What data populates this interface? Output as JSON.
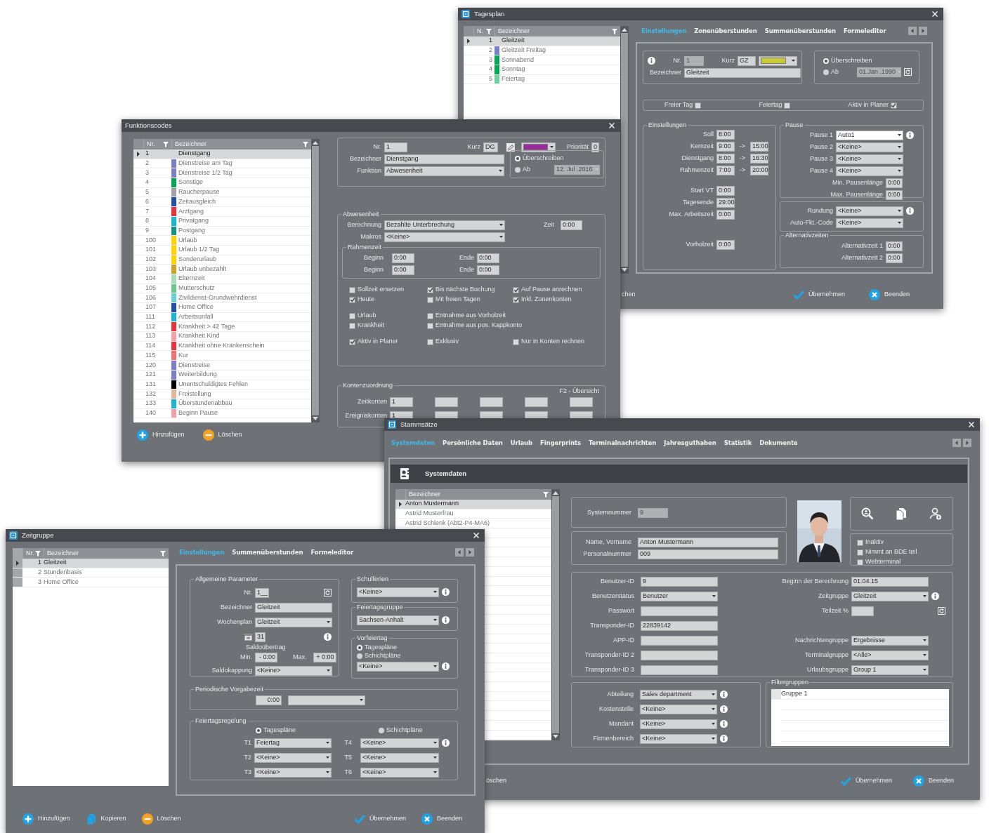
{
  "tagesplan": {
    "title": "Tagesplan",
    "icon": true,
    "list": {
      "columns": [
        "N.",
        "Bezeichner"
      ],
      "rows": [
        {
          "nr": "1",
          "name": "Gleitzeit",
          "selected": true
        },
        {
          "nr": "2",
          "name": "Gleitzeit Freitag",
          "color": "#7b7fc8",
          "selected": false
        },
        {
          "nr": "3",
          "name": "Sonnabend",
          "color": "#00a651",
          "selected": false
        },
        {
          "nr": "4",
          "name": "Sonntag",
          "color": "#00a651",
          "selected": false
        },
        {
          "nr": "5",
          "name": "Feiertag",
          "color": "#6fd0a2",
          "selected": false
        }
      ]
    },
    "tabs": [
      {
        "label": "Einstellungen",
        "selected": true
      },
      {
        "label": "Zonenüberstunden",
        "selected": false
      },
      {
        "label": "Summenüberstunden",
        "selected": false
      },
      {
        "label": "Formeleditor",
        "selected": false
      }
    ],
    "nr": {
      "label": "Nr.",
      "value": "1",
      "kind": "text",
      "disabled": true
    },
    "kurz": {
      "label": "Kurz",
      "value": "GZ",
      "kind": "text"
    },
    "color": {
      "kind": "color",
      "color": "#c9c930"
    },
    "bezeichner": {
      "label": "Bezeichner",
      "value": "Gleitzeit",
      "kind": "text"
    },
    "validity": {
      "options": [
        {
          "label": "Überschreiben",
          "selected": true
        },
        {
          "label": "Ab",
          "selected": false
        }
      ],
      "date": {
        "value": "01.Jan .1990",
        "kind": "date",
        "disabled": true
      }
    },
    "flags": [
      {
        "label": "Freier Tag",
        "checked": false
      },
      {
        "label": "Feiertag",
        "checked": false
      },
      {
        "label": "Aktiv in Planer",
        "checked": true
      }
    ],
    "einstellungen": {
      "title": "Einstellungen",
      "sections": [
        [
          {
            "label": "Soll",
            "from": "8:00"
          },
          {
            "label": "Kernzeit",
            "from": "9:00",
            "arrow": "->",
            "to": "15:00"
          },
          {
            "label": "Dienstgang",
            "from": "8:00",
            "arrow": "->",
            "to": "16:30"
          },
          {
            "label": "Rahmenzeit",
            "from": "7:00",
            "arrow": "->",
            "to": "20:00"
          }
        ],
        [
          {
            "label": "Start VT",
            "from": "0:00"
          },
          {
            "label": "Tagesende",
            "from": "29:00"
          },
          {
            "label": "Max. Arbeitszeit",
            "from": "0:00"
          }
        ],
        [
          {
            "label": "Vorholzeit",
            "from": "0:00"
          }
        ]
      ]
    },
    "pause": {
      "title": "Pause",
      "rows": [
        {
          "label": "Pause 1",
          "value": "Auto1",
          "kind": "combo",
          "focused": true,
          "info": true
        },
        {
          "label": "Pause 2",
          "value": "<Keine>",
          "kind": "combo"
        },
        {
          "label": "Pause 3",
          "value": "<Keine>",
          "kind": "combo"
        },
        {
          "label": "Pause 4",
          "value": "<Keine>",
          "kind": "combo"
        }
      ],
      "lengths": [
        {
          "label": "Min. Pausenlänge",
          "value": "0:00",
          "kind": "text"
        },
        {
          "label": "Max. Pausenlänge",
          "value": "0:00",
          "kind": "text"
        }
      ]
    },
    "rounding": {
      "rows": [
        {
          "label": "Rundung",
          "value": "<Keine>",
          "kind": "combo",
          "info": true
        },
        {
          "label": "Auto-Fkt.-Code",
          "value": "<Keine>",
          "kind": "combo"
        }
      ]
    },
    "alternatives": {
      "title": "Alternativzeiten",
      "rows": [
        {
          "label": "Alternativzeit 1",
          "value": "0:00",
          "kind": "text"
        },
        {
          "label": "Alternativzeit 2",
          "value": "0:00",
          "kind": "text"
        }
      ]
    },
    "footer": [
      {
        "kind": "fragment",
        "label": "chen"
      },
      {
        "kind": "apply",
        "label": "Übernehmen"
      },
      {
        "kind": "close",
        "label": "Beenden"
      }
    ]
  },
  "funktionscodes": {
    "title": "Funktionscodes",
    "list": {
      "columns": [
        "Nr.",
        "Bezeichner"
      ],
      "rows": [
        {
          "nr": "1",
          "name": "Dienstgang",
          "selected": true
        },
        {
          "nr": "2",
          "name": "Dienstreise am Tag",
          "color": "#7b7fc8",
          "selected": false
        },
        {
          "nr": "3",
          "name": "Dienstreise 1/2 Tag",
          "color": "#7b7fc8",
          "selected": false
        },
        {
          "nr": "4",
          "name": "Sonstige",
          "color": "#00a651",
          "selected": false
        },
        {
          "nr": "5",
          "name": "Raucherpause",
          "color": "#a0a0a8",
          "selected": false
        },
        {
          "nr": "6",
          "name": "Zeitausgleich",
          "color": "#1f4fa8",
          "selected": false
        },
        {
          "nr": "7",
          "name": "Arztgang",
          "color": "#e8323c",
          "selected": false
        },
        {
          "nr": "8",
          "name": "Privatgang",
          "color": "#19b5d2",
          "selected": false
        },
        {
          "nr": "9",
          "name": "Postgang",
          "color": "#14928a",
          "selected": false
        },
        {
          "nr": "100",
          "name": "Urlaub",
          "color": "#ffd200",
          "selected": false
        },
        {
          "nr": "101",
          "name": "Urlaub 1/2 Tag",
          "color": "#ffd200",
          "selected": false
        },
        {
          "nr": "102",
          "name": "Sonderurlaub",
          "color": "#ffd200",
          "selected": false
        },
        {
          "nr": "103",
          "name": "Urlaub unbezahlt",
          "color": "#c9a227",
          "selected": false
        },
        {
          "nr": "104",
          "name": "Elternzeit",
          "color": "#a8dcb8",
          "selected": false
        },
        {
          "nr": "105",
          "name": "Mutterschutz",
          "color": "#6cc98a",
          "selected": false
        },
        {
          "nr": "106",
          "name": "Zivildienst-Grundwehrdienst",
          "color": "#6ccfd0",
          "selected": false
        },
        {
          "nr": "107",
          "name": "Home Office",
          "color": "#1f4fa8",
          "selected": false
        },
        {
          "nr": "111",
          "name": "Arbeitsunfall",
          "color": "#19b5d2",
          "selected": false
        },
        {
          "nr": "112",
          "name": "Krankheit > 42 Tage",
          "color": "#e8323c",
          "selected": false
        },
        {
          "nr": "113",
          "name": "Krankheit Kind",
          "color": "#f4a0a8",
          "selected": false
        },
        {
          "nr": "114",
          "name": "Krankheit ohne Krankenschein",
          "color": "#e8323c",
          "selected": false
        },
        {
          "nr": "115",
          "name": "Kur",
          "color": "#ee7078",
          "selected": false
        },
        {
          "nr": "120",
          "name": "Dienstreise",
          "color": "#7b7fc8",
          "selected": false
        },
        {
          "nr": "121",
          "name": "Weiterbildung",
          "color": "#7b7fc8",
          "selected": false
        },
        {
          "nr": "131",
          "name": "Unentschuldigtes Fehlen",
          "color": "#000000",
          "selected": false
        },
        {
          "nr": "132",
          "name": "Freistellung",
          "color": "#e0b898",
          "selected": false
        },
        {
          "nr": "133",
          "name": "Überstundenabbau",
          "color": "#19b5d2",
          "selected": false
        },
        {
          "nr": "140",
          "name": "Beginn Pause",
          "color": "#f4a0a8",
          "selected": false
        }
      ]
    },
    "footer": [
      {
        "kind": "add",
        "label": "Hinzufügen"
      },
      {
        "kind": "remove",
        "label": "Löschen"
      }
    ],
    "nr": {
      "label": "Nr.",
      "value": "1",
      "kind": "text"
    },
    "kurz": {
      "label": "Kurz",
      "value": "DG",
      "kind": "text"
    },
    "color": {
      "kind": "color",
      "color": "#9b2aa0"
    },
    "prioritaet": {
      "label": "Priorität",
      "value": "0",
      "kind": "text"
    },
    "bezeichner": {
      "label": "Bezeichner",
      "value": "Dienstgang",
      "kind": "text"
    },
    "funktion": {
      "label": "Funktion",
      "value": "Abwesenheit",
      "kind": "combo"
    },
    "validity": {
      "options": [
        {
          "label": "Überschreiben",
          "selected": true
        },
        {
          "label": "Ab",
          "selected": false
        }
      ],
      "date": {
        "value": "12. Jul .2016",
        "kind": "date",
        "disabled": true
      }
    },
    "absence": {
      "title": "Abwesenheit",
      "berechnung": {
        "label": "Berechnung",
        "value": "Bezahlte Unterbrechung",
        "kind": "combo"
      },
      "zeit": {
        "label": "Zeit",
        "value": "0:00",
        "kind": "text"
      },
      "makros": {
        "label": "Makros",
        "value": "<Keine>",
        "kind": "combo"
      },
      "frame": {
        "title": "Rahmenzeit",
        "rows": [
          {
            "begin": {
              "label": "Beginn",
              "value": "0:00",
              "kind": "text"
            },
            "end": {
              "label": "Ende",
              "value": "0:00",
              "kind": "text"
            }
          },
          {
            "begin": {
              "label": "Beginn",
              "value": "0:00",
              "kind": "text"
            },
            "end": {
              "label": "Ende",
              "value": "0:00",
              "kind": "text"
            }
          }
        ]
      },
      "option_blocks": [
        {
          "columns": [
            [
              {
                "label": "Sollzeit ersetzen",
                "checked": false
              },
              {
                "label": "Heute",
                "checked": true
              }
            ],
            [
              {
                "label": "Bis nächste Buchung",
                "checked": true
              },
              {
                "label": "Mit freien Tagen",
                "checked": false
              }
            ],
            [
              {
                "label": "Auf Pause anrechnen",
                "checked": true
              },
              {
                "label": "Inkl. Zonenkonten",
                "checked": true
              }
            ]
          ]
        },
        {
          "columns": [
            [
              {
                "label": "Urlaub",
                "checked": false
              },
              {
                "label": "Krankheit",
                "checked": false
              }
            ],
            [
              {
                "label": "Entnahme aus Vorholzeit",
                "checked": false
              },
              {
                "label": "Entnahme aus pos. Kappkonto",
                "checked": false
              }
            ]
          ]
        },
        {
          "columns": [
            [
              {
                "label": "Aktiv in Planer",
                "checked": true
              }
            ],
            [
              {
                "label": "Exklusiv",
                "checked": false
              }
            ],
            [
              {
                "label": "Nur in Konten rechnen",
                "checked": false
              }
            ]
          ]
        }
      ]
    },
    "accounts": {
      "title": "Kontenzuordnung",
      "hint": "F2 - Übersicht",
      "rows": [
        {
          "label": "Zeitkonten",
          "values": [
            "1"
          ]
        },
        {
          "label": "Ereigniskonten",
          "values": [
            "1"
          ]
        }
      ]
    }
  },
  "stammsaetze": {
    "title": "Stammsätze",
    "icon": true,
    "tabs": [
      {
        "label": "Systemdaten",
        "selected": true
      },
      {
        "label": "Persönliche Daten",
        "selected": false
      },
      {
        "label": "Urlaub",
        "selected": false
      },
      {
        "label": "Fingerprints",
        "selected": false
      },
      {
        "label": "Terminalnachrichten",
        "selected": false
      },
      {
        "label": "Jahresguthaben",
        "selected": false
      },
      {
        "label": "Statistik",
        "selected": false
      },
      {
        "label": "Dokumente",
        "selected": false
      }
    ],
    "section": "Systemdaten",
    "list": {
      "columns": [
        "Bezeichner"
      ],
      "rows": [
        {
          "name": "Anton Mustermann",
          "selected": true
        },
        {
          "name": "Astrid Musterfrau",
          "selected": false
        },
        {
          "name": "Astrid Schlenk (Abt2-P4-MA6)",
          "selected": false
        }
      ]
    },
    "systemnummer": {
      "label": "Systemnummer",
      "value": "9",
      "kind": "text",
      "disabled": true
    },
    "identity": [
      {
        "label": "Name, Vorname",
        "value": "Anton Mustermann",
        "kind": "text"
      },
      {
        "label": "Personalnummer",
        "value": "009",
        "kind": "text"
      }
    ],
    "photo": {
      "kind": "picture"
    },
    "flags": [
      {
        "label": "Inaktiv",
        "checked": false
      },
      {
        "label": "Nimmt an BDE teil",
        "checked": false
      },
      {
        "label": "Webterminal",
        "checked": false
      }
    ],
    "user_left": [
      {
        "label": "Benutzer-ID",
        "value": "9",
        "kind": "text"
      },
      {
        "label": "Benutzerstatus",
        "value": "Benutzer",
        "kind": "combo"
      },
      {
        "label": "Passwort",
        "kind": "text"
      },
      {
        "label": "Transponder-ID",
        "value": "22839142",
        "kind": "text"
      },
      {
        "label": "APP-ID",
        "kind": "text"
      },
      {
        "label": "Transponder-ID 2",
        "kind": "text"
      },
      {
        "label": "Transponder-ID 3",
        "kind": "text"
      }
    ],
    "user_right": [
      [
        {
          "label": "Beginn der Berechnung",
          "value": "01.04.15",
          "kind": "text"
        },
        {
          "label": "Zeitgruppe",
          "value": "Gleitzeit",
          "kind": "combo",
          "info": true
        },
        {
          "label": "Teilzeit %",
          "kind": "text",
          "reset": true
        }
      ],
      [
        {
          "label": "Nachrichtengruppe",
          "value": "Ergebnisse",
          "kind": "combo"
        },
        {
          "label": "Terminalgruppe",
          "value": "<Alle>",
          "kind": "combo"
        },
        {
          "label": "Urlaubsgruppe",
          "value": "Group 1",
          "kind": "combo"
        }
      ]
    ],
    "org": [
      {
        "label": "Abteilung",
        "value": "Sales department",
        "kind": "combo",
        "info": true
      },
      {
        "label": "Kostenstelle",
        "value": "<Keine>",
        "kind": "combo",
        "info": true
      },
      {
        "label": "Mandant",
        "value": "<Keine>",
        "kind": "combo",
        "info": true
      },
      {
        "label": "Firmenbereich",
        "value": "<Keine>",
        "kind": "combo",
        "info": true
      }
    ],
    "filter_groups": {
      "title": "Filtergruppen",
      "rows": [
        "Gruppe 1"
      ]
    },
    "footer": [
      {
        "kind": "fragment",
        "label": "öschen"
      },
      {
        "kind": "apply",
        "label": "Übernehmen"
      },
      {
        "kind": "close",
        "label": "Beenden"
      }
    ]
  },
  "zeitgruppe": {
    "title": "Zeitgruppe",
    "icon": true,
    "list": {
      "columns": [
        "Nr.",
        "Bezeichner"
      ],
      "rows": [
        {
          "nr": "1",
          "name": "Gleitzeit",
          "selected": true
        },
        {
          "nr": "2",
          "name": "Stundenbasis",
          "selected": false
        },
        {
          "nr": "3",
          "name": "Home Office",
          "selected": false
        }
      ]
    },
    "tabs": [
      {
        "label": "Einstellungen",
        "selected": true
      },
      {
        "label": "Summenüberstunden",
        "selected": false
      },
      {
        "label": "Formeleditor",
        "selected": false
      }
    ],
    "general": {
      "title": "Allgemeine Parameter",
      "nr": {
        "label": "Nr.",
        "value": "1__",
        "kind": "text",
        "reset": true
      },
      "bezeichner": {
        "label": "Bezeichner",
        "value": "Gleitzeit",
        "kind": "text"
      },
      "wochenplan": {
        "label": "Wochenplan",
        "value": "Gleitzeit",
        "kind": "combo"
      },
      "day": {
        "value": "31",
        "kind": "text",
        "info": true
      },
      "carry": {
        "title": "Saldoübertrag",
        "min": {
          "label": "Min.",
          "value": "- 0:00",
          "kind": "text"
        },
        "max": {
          "label": "Max.",
          "value": "+ 0:00",
          "kind": "text"
        }
      },
      "kappung": {
        "label": "Saldokappung",
        "value": "<Keine>",
        "kind": "combo"
      }
    },
    "schulferien": {
      "title": "Schulferien",
      "field": {
        "value": "<Keine>",
        "kind": "combo",
        "info": true
      }
    },
    "feiertagsgruppe": {
      "title": "Feiertagsgruppe",
      "field": {
        "value": "Sachsen-Anhalt",
        "kind": "combo",
        "info": true
      }
    },
    "vorfeiertag": {
      "title": "Vorfeiertag",
      "options": [
        {
          "label": "Tagespläne",
          "selected": true
        },
        {
          "label": "Schichtpläne",
          "selected": false
        }
      ],
      "field": {
        "value": "<Keine>",
        "kind": "combo",
        "info": true
      }
    },
    "vorgabezeit": {
      "title": "Periodische Vorgabezeit",
      "time": {
        "value": "0:00",
        "kind": "text"
      },
      "unit": {
        "kind": "combo"
      }
    },
    "holiday_rules": {
      "title": "Feiertagsregelung",
      "options": [
        {
          "label": "Tagespläne",
          "selected": true
        },
        {
          "label": "Schichtpläne",
          "selected": false
        }
      ],
      "rows": [
        {
          "left": {
            "label": "T1",
            "value": "Feiertag",
            "kind": "combo"
          },
          "right": {
            "label": "T4",
            "value": "<Keine>",
            "kind": "combo",
            "info": true
          }
        },
        {
          "left": {
            "label": "T2",
            "value": "<Keine>",
            "kind": "combo"
          },
          "right": {
            "label": "T5",
            "value": "<Keine>",
            "kind": "combo"
          }
        },
        {
          "left": {
            "label": "T3",
            "value": "<Keine>",
            "kind": "combo"
          },
          "right": {
            "label": "T6",
            "value": "<Keine>",
            "kind": "combo"
          }
        }
      ]
    },
    "footer": [
      {
        "kind": "add",
        "label": "Hinzufügen"
      },
      {
        "kind": "copy",
        "label": "Kopieren"
      },
      {
        "kind": "remove",
        "label": "Löschen"
      },
      {
        "kind": "apply",
        "label": "Übernehmen"
      },
      {
        "kind": "close",
        "label": "Beenden"
      }
    ]
  }
}
